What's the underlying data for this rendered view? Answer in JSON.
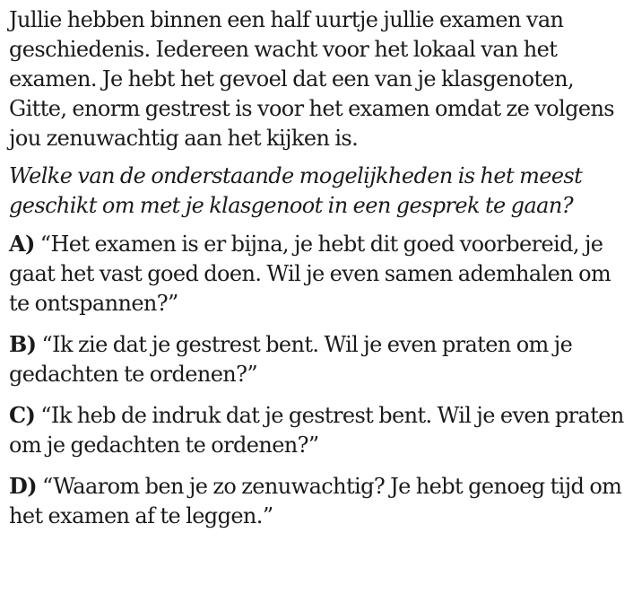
{
  "intro": {
    "lines": [
      "Jullie hebben binnen een half uurtje jullie examen van",
      "geschiedenis. Iedereen wacht voor het lokaal van het",
      "examen. Je hebt het gevoel dat een van je klasgenoten,",
      "Gitte, enorm gestrest is voor het examen omdat ze volgens",
      "jou zenuwachtig aan het kijken is."
    ]
  },
  "question": {
    "lines": [
      "Welke van de onderstaande mogelijkheden is het meest",
      "geschikt om met je klasgenoot in een gesprek te gaan?"
    ]
  },
  "options": [
    {
      "letter": "A)",
      "lines": [
        "“Het examen is er bijna, je hebt dit goed voorbereid, je",
        "gaat het vast goed doen. Wil je even samen ademhalen om",
        "te ontspannen?”"
      ]
    },
    {
      "letter": "B)",
      "lines": [
        "“Ik zie dat je gestrest bent. Wil je even praten om je",
        "gedachten te ordenen?”"
      ]
    },
    {
      "letter": "C)",
      "lines": [
        "“Ik heb de indruk dat je gestrest bent. Wil je even praten",
        "om je gedachten te ordenen?”"
      ]
    },
    {
      "letter": "D)",
      "lines": [
        "“Waarom ben je zo zenuwachtig? Je hebt genoeg tijd om",
        "het examen af te leggen.”"
      ]
    }
  ]
}
